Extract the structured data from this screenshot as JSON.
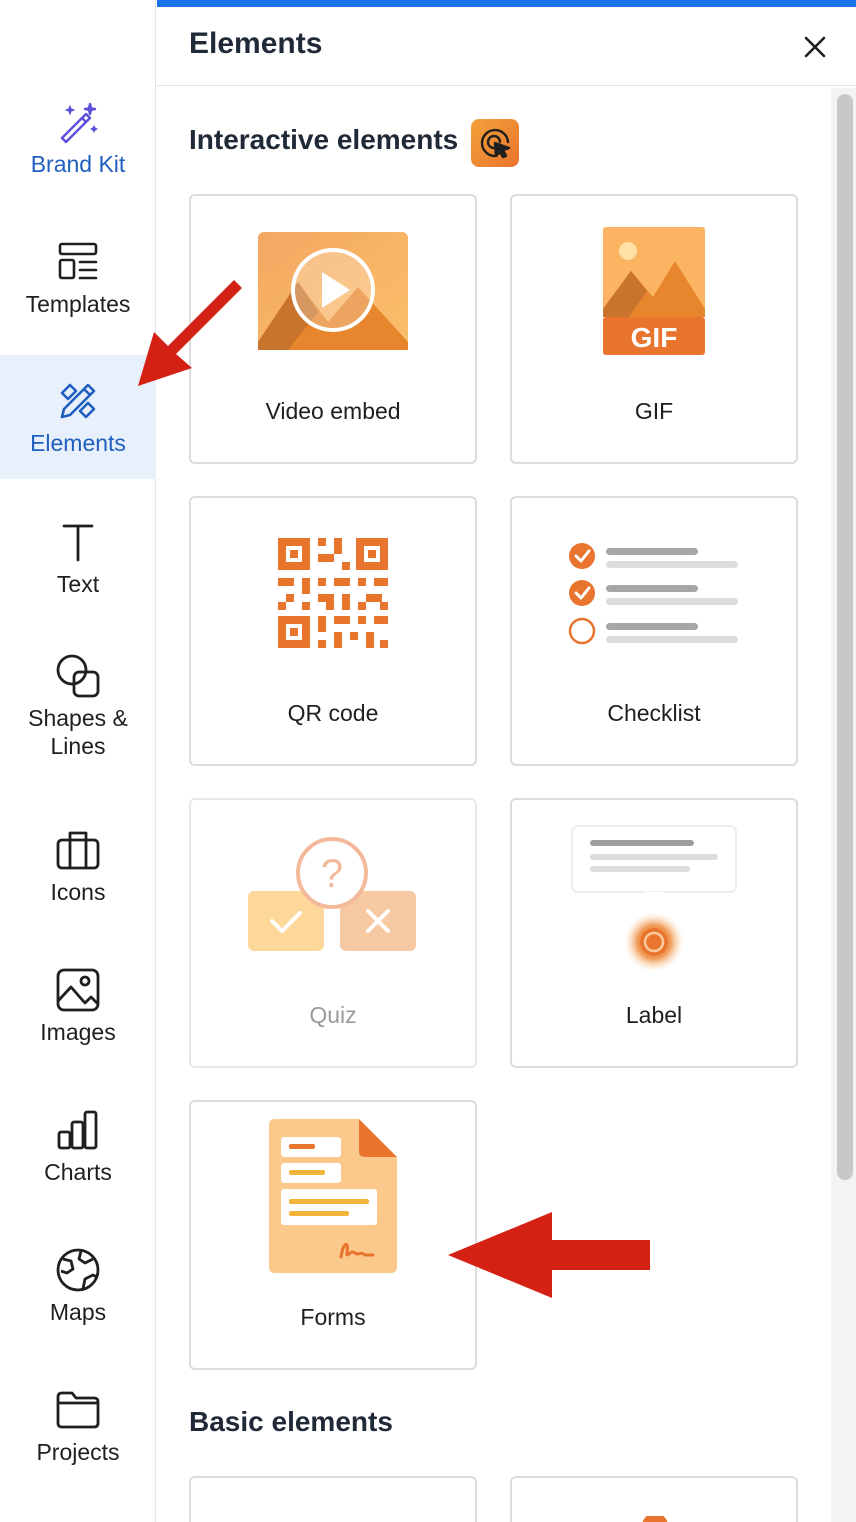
{
  "sidebar": {
    "items": [
      {
        "label": "Brand Kit",
        "icon": "magic-wand-icon"
      },
      {
        "label": "Templates",
        "icon": "templates-icon"
      },
      {
        "label": "Elements",
        "icon": "elements-icon"
      },
      {
        "label": "Text",
        "icon": "text-icon"
      },
      {
        "label": "Shapes &\nLines",
        "icon": "shapes-icon"
      },
      {
        "label": "Icons",
        "icon": "briefcase-icon"
      },
      {
        "label": "Images",
        "icon": "image-icon"
      },
      {
        "label": "Charts",
        "icon": "bar-chart-icon"
      },
      {
        "label": "Maps",
        "icon": "globe-icon"
      },
      {
        "label": "Projects",
        "icon": "folder-icon"
      }
    ],
    "active": "Elements"
  },
  "panel": {
    "title": "Elements",
    "close_icon": "close-icon",
    "interactive_title": "Interactive elements",
    "basic_title": "Basic elements",
    "cards": [
      {
        "label": "Video embed",
        "icon": "video-embed-icon"
      },
      {
        "label": "GIF",
        "icon": "gif-icon",
        "art_text": "GIF"
      },
      {
        "label": "QR code",
        "icon": "qr-code-icon"
      },
      {
        "label": "Checklist",
        "icon": "checklist-icon"
      },
      {
        "label": "Quiz",
        "icon": "quiz-icon",
        "disabled": true
      },
      {
        "label": "Label",
        "icon": "label-icon"
      },
      {
        "label": "Forms",
        "icon": "forms-icon"
      }
    ]
  },
  "colors": {
    "accent_blue": "#1a73e8",
    "active_bg": "#e8f0fb",
    "orange": "#e8742d",
    "arrow_red": "#d42114"
  }
}
